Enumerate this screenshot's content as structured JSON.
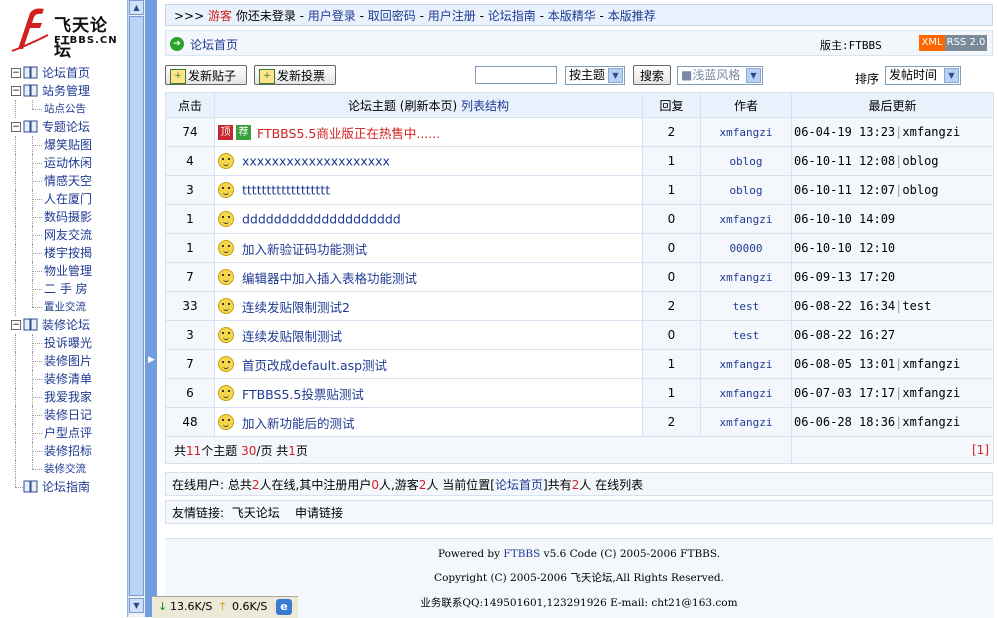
{
  "logo": {
    "name": "飞天论坛",
    "sub": "FTBBS.CN"
  },
  "tree": [
    {
      "label": "论坛首页",
      "type": "root"
    },
    {
      "label": "站务管理",
      "type": "group",
      "children": [
        "站点公告"
      ]
    },
    {
      "label": "专题论坛",
      "type": "group",
      "children": [
        "爆笑贴图",
        "运动休闲",
        "情感天空",
        "人在厦门",
        "数码摄影",
        "网友交流",
        "楼宇按揭",
        "物业管理",
        "二 手 房",
        "置业交流"
      ]
    },
    {
      "label": "装修论坛",
      "type": "group",
      "children": [
        "投诉曝光",
        "装修图片",
        "装修清单",
        "我爱我家",
        "装修日记",
        "户型点评",
        "装修招标",
        "装修交流"
      ]
    },
    {
      "label": "论坛指南",
      "type": "leaf"
    }
  ],
  "topnav": {
    "prefix": ">>> ",
    "guest": "游客",
    "not_logged": " 你还未登录 - ",
    "links": [
      "用户登录",
      "取回密码",
      "用户注册",
      "论坛指南",
      "本版精华",
      "本版推荐"
    ]
  },
  "crumb": {
    "home": "论坛首页",
    "moderator": "版主:FTBBS",
    "xml": "XML",
    "rss": "RSS 2.0"
  },
  "toolbar": {
    "new_post": "发新贴子",
    "new_poll": "发新投票",
    "search_value": "",
    "search_scope": "按主题",
    "search_button": "搜索",
    "style": "■浅蓝风格",
    "sort_label": "排序",
    "sort_value": "发帖时间"
  },
  "table": {
    "headers": {
      "clicks": "点击",
      "topic": "论坛主题 (刷新本页)",
      "topic_link": "列表结构",
      "replies": "回复",
      "author": "作者",
      "last": "最后更新"
    },
    "rows": [
      {
        "clicks": "74",
        "title": "FTBBS5.5商业版正在热售中......",
        "top": "顶",
        "rec": "荐",
        "replies": "2",
        "author": "xmfangzi",
        "last_time": "06-04-19 13:23",
        "last_user": "xmfangzi"
      },
      {
        "clicks": "4",
        "title": "xxxxxxxxxxxxxxxxxxxx",
        "replies": "1",
        "author": "oblog",
        "last_time": "06-10-11 12:08",
        "last_user": "oblog"
      },
      {
        "clicks": "3",
        "title": "tttttttttttttttttt",
        "replies": "1",
        "author": "oblog",
        "last_time": "06-10-11 12:07",
        "last_user": "oblog"
      },
      {
        "clicks": "1",
        "title": "dddddddddddddddddddd",
        "replies": "0",
        "author": "xmfangzi",
        "last_time": "06-10-10 14:09",
        "last_user": ""
      },
      {
        "clicks": "1",
        "title": "加入新验证码功能测试",
        "replies": "0",
        "author": "00000",
        "last_time": "06-10-10 12:10",
        "last_user": ""
      },
      {
        "clicks": "7",
        "title": "编辑器中加入插入表格功能测试",
        "replies": "0",
        "author": "xmfangzi",
        "last_time": "06-09-13 17:20",
        "last_user": ""
      },
      {
        "clicks": "33",
        "title": "连续发贴限制测试2",
        "replies": "2",
        "author": "test",
        "last_time": "06-08-22 16:34",
        "last_user": "test"
      },
      {
        "clicks": "3",
        "title": "连续发贴限制测试",
        "replies": "0",
        "author": "test",
        "last_time": "06-08-22 16:27",
        "last_user": ""
      },
      {
        "clicks": "7",
        "title": "首页改成default.asp测试",
        "replies": "1",
        "author": "xmfangzi",
        "last_time": "06-08-05 13:01",
        "last_user": "xmfangzi"
      },
      {
        "clicks": "6",
        "title": "FTBBS5.5投票贴测试",
        "replies": "1",
        "author": "xmfangzi",
        "last_time": "06-07-03 17:17",
        "last_user": "xmfangzi"
      },
      {
        "clicks": "48",
        "title": "加入新功能后的测试",
        "replies": "2",
        "author": "xmfangzi",
        "last_time": "06-06-28 18:36",
        "last_user": "xmfangzi"
      }
    ],
    "footer": {
      "p1": "共",
      "topics": "11",
      "p2": "个主题 ",
      "per_page": "30",
      "p3": "/页 共",
      "pages": "1",
      "p4": "页",
      "page_link": "[1]"
    }
  },
  "online": {
    "a": "在线用户: 总共",
    "total": "2",
    "b": "人在线,其中注册用户",
    "reg": "0",
    "c": "人,游客",
    "guests": "2",
    "d": "人 当前位置[",
    "loc": "论坛首页",
    "e": "]共有",
    "here": "2",
    "f": "人 在线列表"
  },
  "friend": {
    "label": "友情链接:",
    "link1": "飞天论坛",
    "link2": "申请链接"
  },
  "footer": {
    "powered_a": "Powered by ",
    "powered_link": "FTBBS",
    "powered_b": " v5.6 Code (C) 2005-2006 FTBBS.",
    "copyright": "Copyright (C) 2005-2006 飞天论坛,All Rights Reserved.",
    "contact": "业务联系QQ:149501601,123291926 E-mail: cht21@163.com"
  },
  "status": {
    "down": "13.6K/S",
    "up": "0.6K/S"
  },
  "colors": {
    "accent": "#1f3a93",
    "hot": "#d21f1f",
    "header_bg": "#e8f1fc",
    "splitter": "#6f9ee0"
  }
}
